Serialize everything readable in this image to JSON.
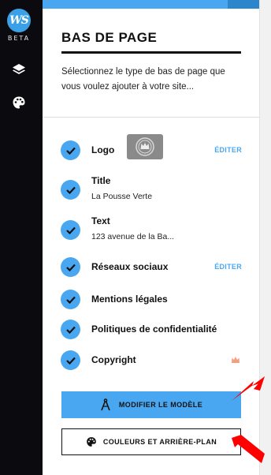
{
  "brand": {
    "logo_text": "WS",
    "badge": "BETA"
  },
  "panel": {
    "title": "BAS DE PAGE",
    "description": "Sélectionnez le type de bas de page que vous voulez ajouter à votre site..."
  },
  "items": [
    {
      "label": "Logo",
      "checked": true,
      "action": "ÉDITER"
    },
    {
      "label": "Title",
      "value": "La Pousse Verte",
      "checked": true
    },
    {
      "label": "Text",
      "value": "123 avenue de la Ba...",
      "checked": true
    },
    {
      "label": "Réseaux sociaux",
      "checked": true,
      "action": "ÉDITER"
    },
    {
      "label": "Mentions légales",
      "checked": true
    },
    {
      "label": "Politiques de confidentialité",
      "checked": true
    },
    {
      "label": "Copyright",
      "checked": true,
      "premium": true
    }
  ],
  "buttons": {
    "modify": "MODIFIER LE MODÈLE",
    "colors": "COULEURS ET ARRIÈRE-PLAN"
  },
  "colors": {
    "accent": "#48a7f0",
    "rail": "#0b0b0f",
    "annotation": "#ff0000",
    "premium": "#f0a080"
  },
  "icons": [
    "layers-icon",
    "palette-icon",
    "crown-icon",
    "compass-icon",
    "check-icon"
  ]
}
